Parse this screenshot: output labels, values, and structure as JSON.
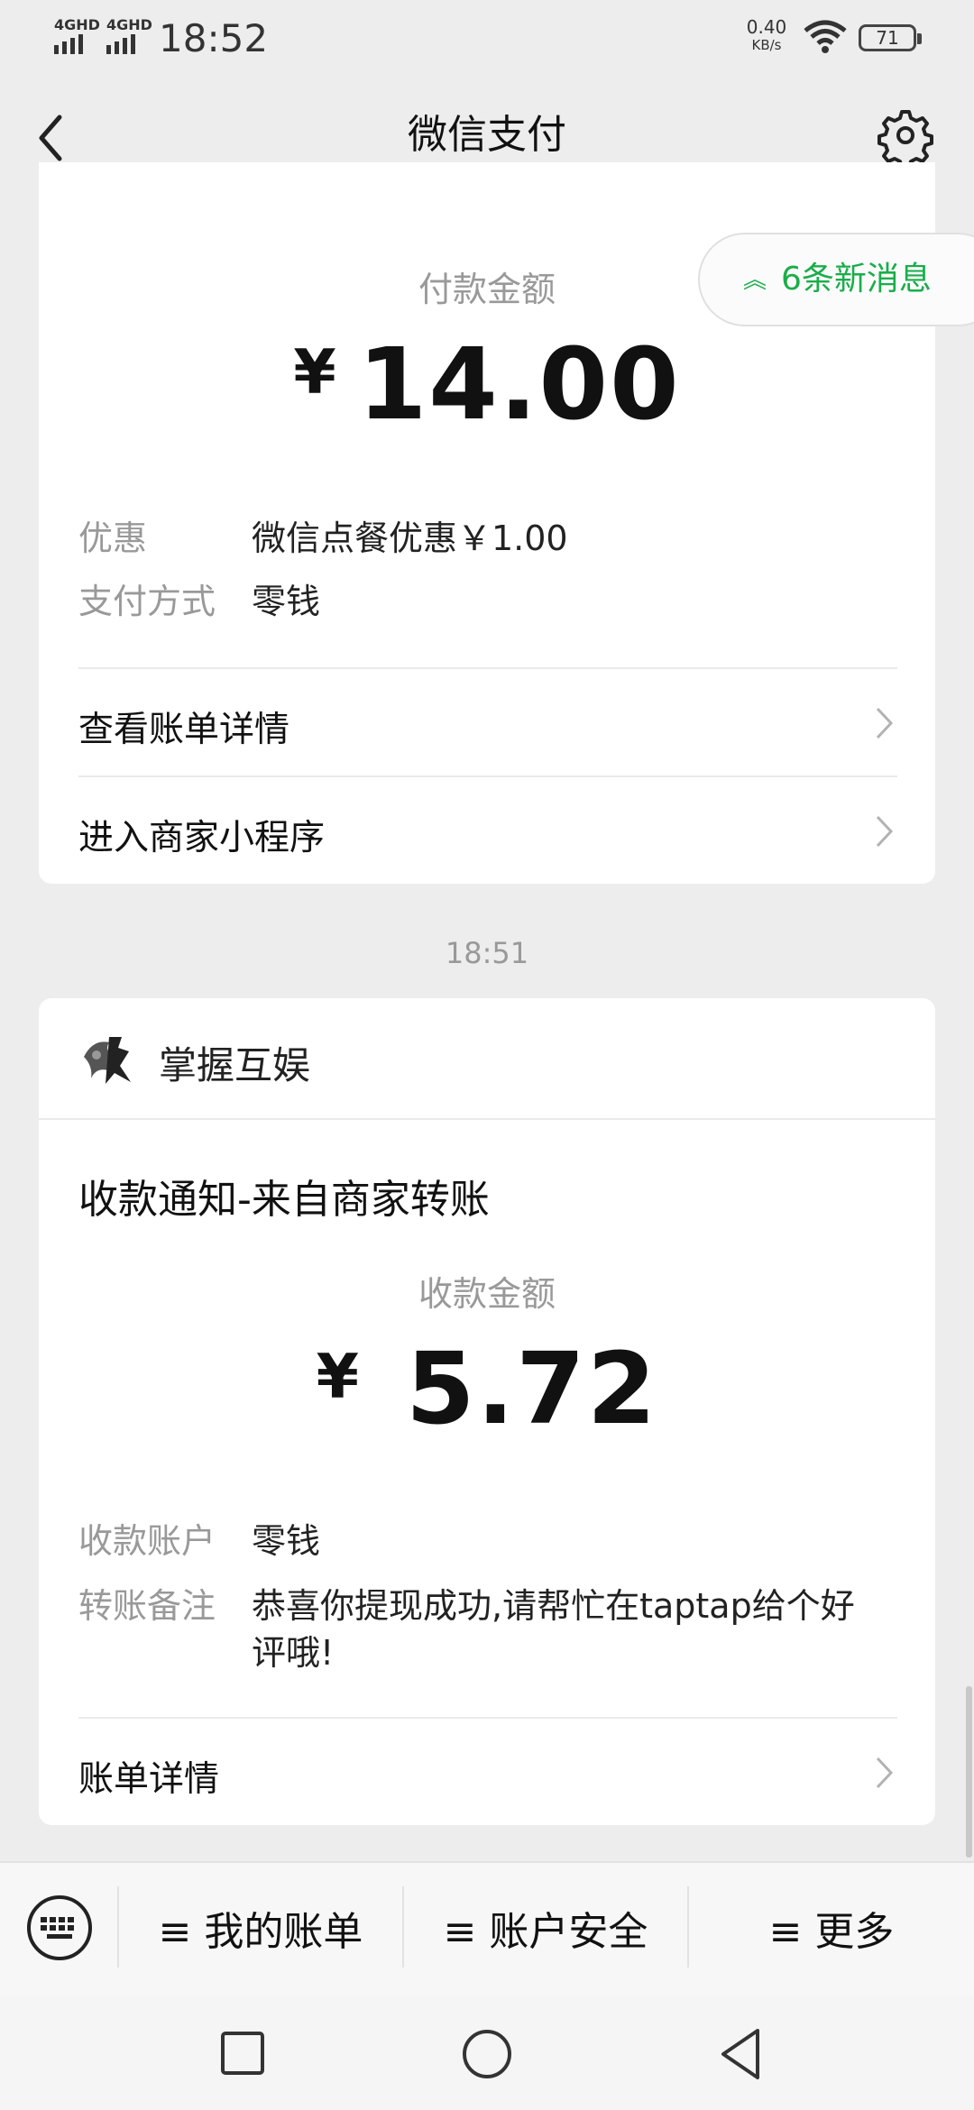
{
  "status_bar": {
    "network_1": "4GHD",
    "network_2": "4GHD",
    "time": "18:52",
    "speed_value": "0.40",
    "speed_unit": "KB/s",
    "battery": "71"
  },
  "nav": {
    "title": "微信支付",
    "back_icon": "chevron-left-icon",
    "settings_icon": "gear-icon"
  },
  "payment_card": {
    "amount_label": "付款金额",
    "currency": "¥",
    "amount": "14.00",
    "details": [
      {
        "key": "优惠",
        "value": "微信点餐优惠￥1.00"
      },
      {
        "key": "支付方式",
        "value": "零钱"
      }
    ],
    "links": [
      "查看账单详情",
      "进入商家小程序"
    ]
  },
  "new_messages": "6条新消息",
  "timestamp": "18:51",
  "receipt_card": {
    "merchant": "掌握互娱",
    "title": "收款通知-来自商家转账",
    "amount_label": "收款金额",
    "currency": "¥",
    "amount": "5.72",
    "details": [
      {
        "key": "收款账户",
        "value": "零钱"
      },
      {
        "key": "转账备注",
        "value_line1": "恭喜你提现成功,请帮忙在taptap给个好",
        "value_line2": "评哦!"
      }
    ],
    "link": "账单详情"
  },
  "bottom_menu": {
    "keyboard_icon": "keyboard-icon",
    "items": [
      "≡ 我的账单",
      "≡ 账户安全",
      "≡ 更多"
    ]
  },
  "system_nav": {
    "icons": [
      "recents-square-icon",
      "home-circle-icon",
      "back-triangle-icon"
    ]
  },
  "colors": {
    "accent_green": "#1aad4a",
    "background": "#ededed"
  }
}
